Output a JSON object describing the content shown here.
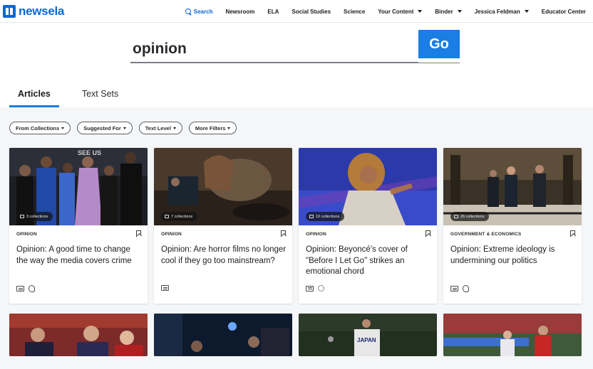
{
  "brand": {
    "name": "newsela",
    "color": "#0b66d6"
  },
  "nav": {
    "search": "Search",
    "newsroom": "Newsroom",
    "ela": "ELA",
    "social_studies": "Social Studies",
    "science": "Science",
    "your_content": "Your Content",
    "binder": "Binder",
    "user": "Jessica Feldman",
    "educator_center": "Educator Center"
  },
  "search": {
    "value": "opinion",
    "go_label": "Go",
    "go_color": "#1a7ee3"
  },
  "tabs": [
    {
      "label": "Articles",
      "active": true
    },
    {
      "label": "Text Sets",
      "active": false
    }
  ],
  "filters": [
    "From Collections",
    "Suggested For",
    "Text Level",
    "More Filters"
  ],
  "cards": [
    {
      "collections": "3 collections",
      "category": "OPINION",
      "title": "Opinion: A good time to change the way the media covers crime",
      "icons": [
        "book-icon",
        "audio-icon"
      ]
    },
    {
      "collections": "7 collections",
      "category": "OPINION",
      "title": "Opinion: Are horror films no longer cool if they go too mainstream?",
      "icons": [
        "book-icon"
      ]
    },
    {
      "collections": "10 collections",
      "category": "OPINION",
      "title": "Opinion: Beyoncé's cover of \"Before I Let Go\" strikes an emotional chord",
      "icons": [
        "book-icon",
        "quiz-icon"
      ]
    },
    {
      "collections": "26 collections",
      "category": "GOVERNMENT & ECONOMICS",
      "title": "Opinion: Extreme ideology is undermining our politics",
      "icons": [
        "book-icon",
        "audio-icon"
      ]
    }
  ]
}
